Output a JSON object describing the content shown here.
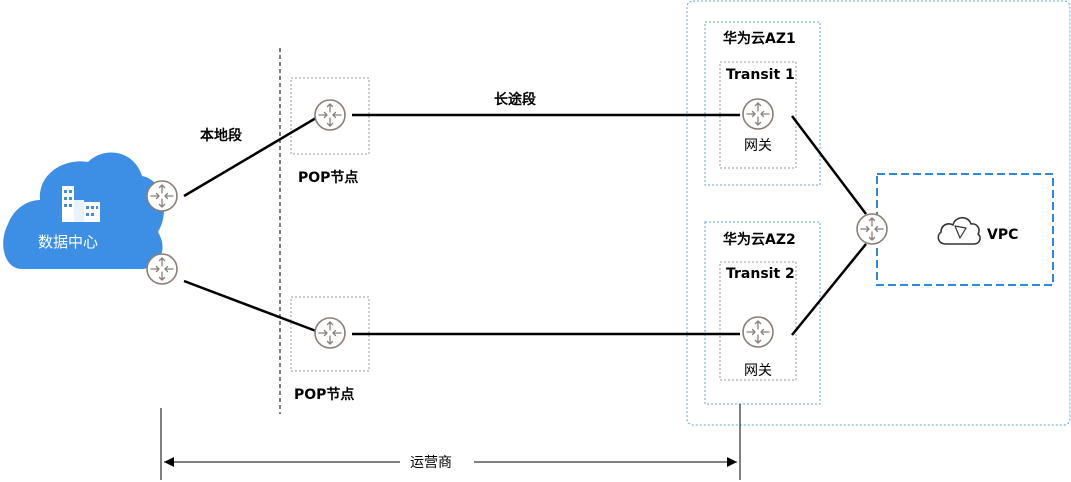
{
  "datacenter": {
    "label": "数据中心"
  },
  "segments": {
    "local": "本地段",
    "long_haul": "长途段",
    "carrier": "运营商"
  },
  "pop": {
    "top_label": "POP节点",
    "bottom_label": "POP节点"
  },
  "cloud": {
    "az1": {
      "title": "华为云AZ1",
      "transit": "Transit 1",
      "gateway": "网关"
    },
    "az2": {
      "title": "华为云AZ2",
      "transit": "Transit 2",
      "gateway": "网关"
    },
    "vpc": {
      "label": "VPC"
    }
  },
  "colors": {
    "cloud_blue": "#3d8fe6",
    "dashed_blue": "#2e86de",
    "region_border": "#5aa8dc",
    "router_gray": "#8a7f78",
    "line": "#000000"
  }
}
